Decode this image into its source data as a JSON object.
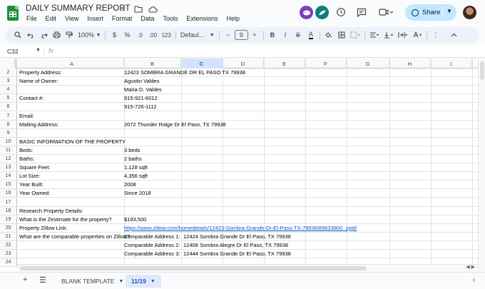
{
  "doc": {
    "title": "DAILY SUMMARY REPORT"
  },
  "menu": [
    "File",
    "Edit",
    "View",
    "Insert",
    "Format",
    "Data",
    "Tools",
    "Extensions",
    "Help"
  ],
  "share": {
    "label": "Share"
  },
  "toolbar": {
    "zoom": "100%",
    "currency": "$",
    "percent": "%",
    "dec_dec": ".0",
    "dec_inc": ".00",
    "num_format": "123",
    "font": "Defaul...",
    "font_size": "9",
    "minus": "−",
    "plus": "+",
    "bold": "B",
    "italic": "I",
    "strike": "S",
    "text_color": "A"
  },
  "formula_bar": {
    "cell_ref": "C32",
    "fx": "fx"
  },
  "columns": [
    "A",
    "B",
    "C",
    "D",
    "E",
    "F",
    "G",
    "H",
    "I"
  ],
  "rows": [
    {
      "n": "2",
      "a": "Property Address:",
      "b": "12423 SOMBRA GRANDE DR EL PASO TX 79938"
    },
    {
      "n": "3",
      "a": "Name of Owner:",
      "b": "Agustin Valdes"
    },
    {
      "n": "4",
      "a": "",
      "b": "Maria D. Valdes"
    },
    {
      "n": "5",
      "a": "Contact #:",
      "b": "915-921-6012"
    },
    {
      "n": "6",
      "a": "",
      "b": "915-726-1112"
    },
    {
      "n": "7",
      "a": "Email:",
      "b": ""
    },
    {
      "n": "8",
      "a": "Mailing Address:",
      "b": "2072 Thunder Ridge Dr El Paso, TX 79938"
    },
    {
      "n": "9",
      "a": "",
      "b": ""
    },
    {
      "n": "10",
      "a": "BASIC INFORMATION OF THE PROPERTY",
      "b": ""
    },
    {
      "n": "11",
      "a": "Beds:",
      "b": "3 beds"
    },
    {
      "n": "12",
      "a": "Baths:",
      "b": "2 baths"
    },
    {
      "n": "13",
      "a": "Square Feet:",
      "b": "1,128 sqft"
    },
    {
      "n": "14",
      "a": "Lot Size:",
      "b": "4,356 sqft"
    },
    {
      "n": "15",
      "a": "Year Built:",
      "b": "2008"
    },
    {
      "n": "16",
      "a": "Year Owned:",
      "b": "Since 2018"
    },
    {
      "n": "17",
      "a": "",
      "b": ""
    },
    {
      "n": "18",
      "a": "Research Property Details:",
      "b": ""
    },
    {
      "n": "19",
      "a": "What is the Zestimate for the property?",
      "b": "$193,500"
    },
    {
      "n": "20",
      "a": "Property Zillow Link:",
      "b": "https://www.zillow.com/homedetails/12423-Sombra-Grande-Dr-El-Paso-TX-79938/89633800_zpid/",
      "link": true
    },
    {
      "n": "21",
      "a": "What are the comparable properties on Zillow?",
      "b": "Comparable Address 1:",
      "c": "12424 Sombra Grande Dr El Paso, TX 79938"
    },
    {
      "n": "22",
      "a": "",
      "b": "Comparable Address 2:",
      "c": "12408 Sombra Alegre Dr El Paso, TX 79938"
    },
    {
      "n": "23",
      "a": "",
      "b": "Comparable Address 3:",
      "c": "12444 Sombra Grande Dr El Paso, TX 79938"
    },
    {
      "n": "24",
      "a": "",
      "b": ""
    }
  ],
  "sheets": [
    {
      "label": "BLANK TEMPLATE",
      "active": false
    },
    {
      "label": "11/19",
      "active": true
    }
  ],
  "colors": {
    "accent": "#0b57d0",
    "share_bg": "#c2e7ff",
    "toolbar_bg": "#edf2fa",
    "selected_col": "#d3e3fd",
    "link": "#1155cc"
  }
}
